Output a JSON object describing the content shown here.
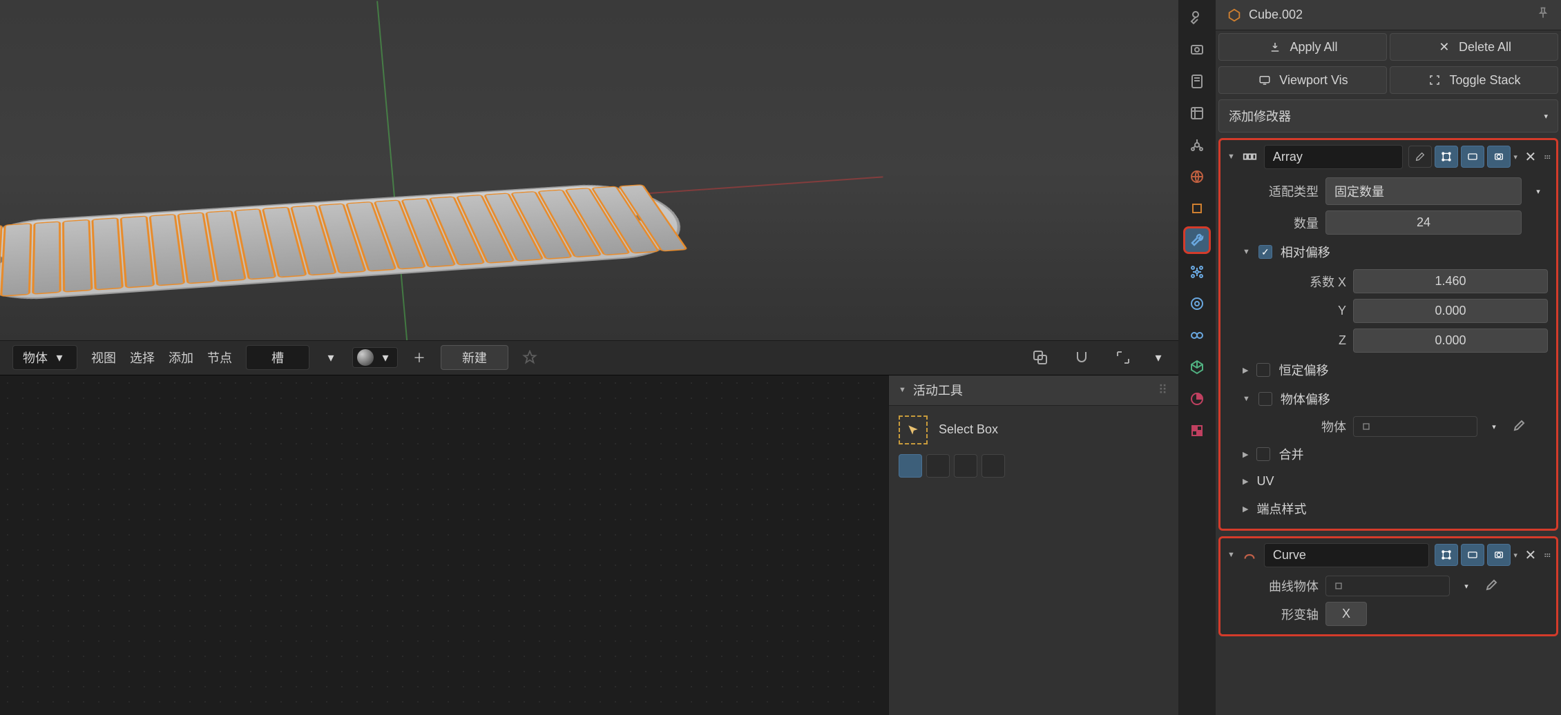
{
  "object_name": "Cube.002",
  "buttons": {
    "apply_all": "Apply All",
    "delete_all": "Delete All",
    "viewport_vis": "Viewport Vis",
    "toggle_stack": "Toggle Stack"
  },
  "add_modifier": "添加修改器",
  "shader": {
    "mode": "物体",
    "view": "视图",
    "select": "选择",
    "add": "添加",
    "node": "节点",
    "slot": "槽",
    "new": "新建"
  },
  "tool": {
    "header": "活动工具",
    "name": "Select Box"
  },
  "modifiers": {
    "array": {
      "name": "Array",
      "fit_type_label": "适配类型",
      "fit_type_value": "固定数量",
      "count_label": "数量",
      "count_value": "24",
      "rel_offset": "相对偏移",
      "factor_label": "系数 X",
      "y_label": "Y",
      "z_label": "Z",
      "fx": "1.460",
      "fy": "0.000",
      "fz": "0.000",
      "const_offset": "恒定偏移",
      "obj_offset": "物体偏移",
      "object_label": "物体",
      "merge": "合并",
      "uv": "UV",
      "vertex_style": "端点样式"
    },
    "curve": {
      "name": "Curve",
      "curve_object": "曲线物体",
      "deform_axis": "形变轴",
      "deform_axis_value": "X"
    }
  },
  "rail_tabs": [
    "tool",
    "render",
    "output",
    "viewlayer",
    "scene",
    "world",
    "object",
    "modifier",
    "particle",
    "physics",
    "constraint",
    "mesh",
    "material",
    "texture"
  ]
}
